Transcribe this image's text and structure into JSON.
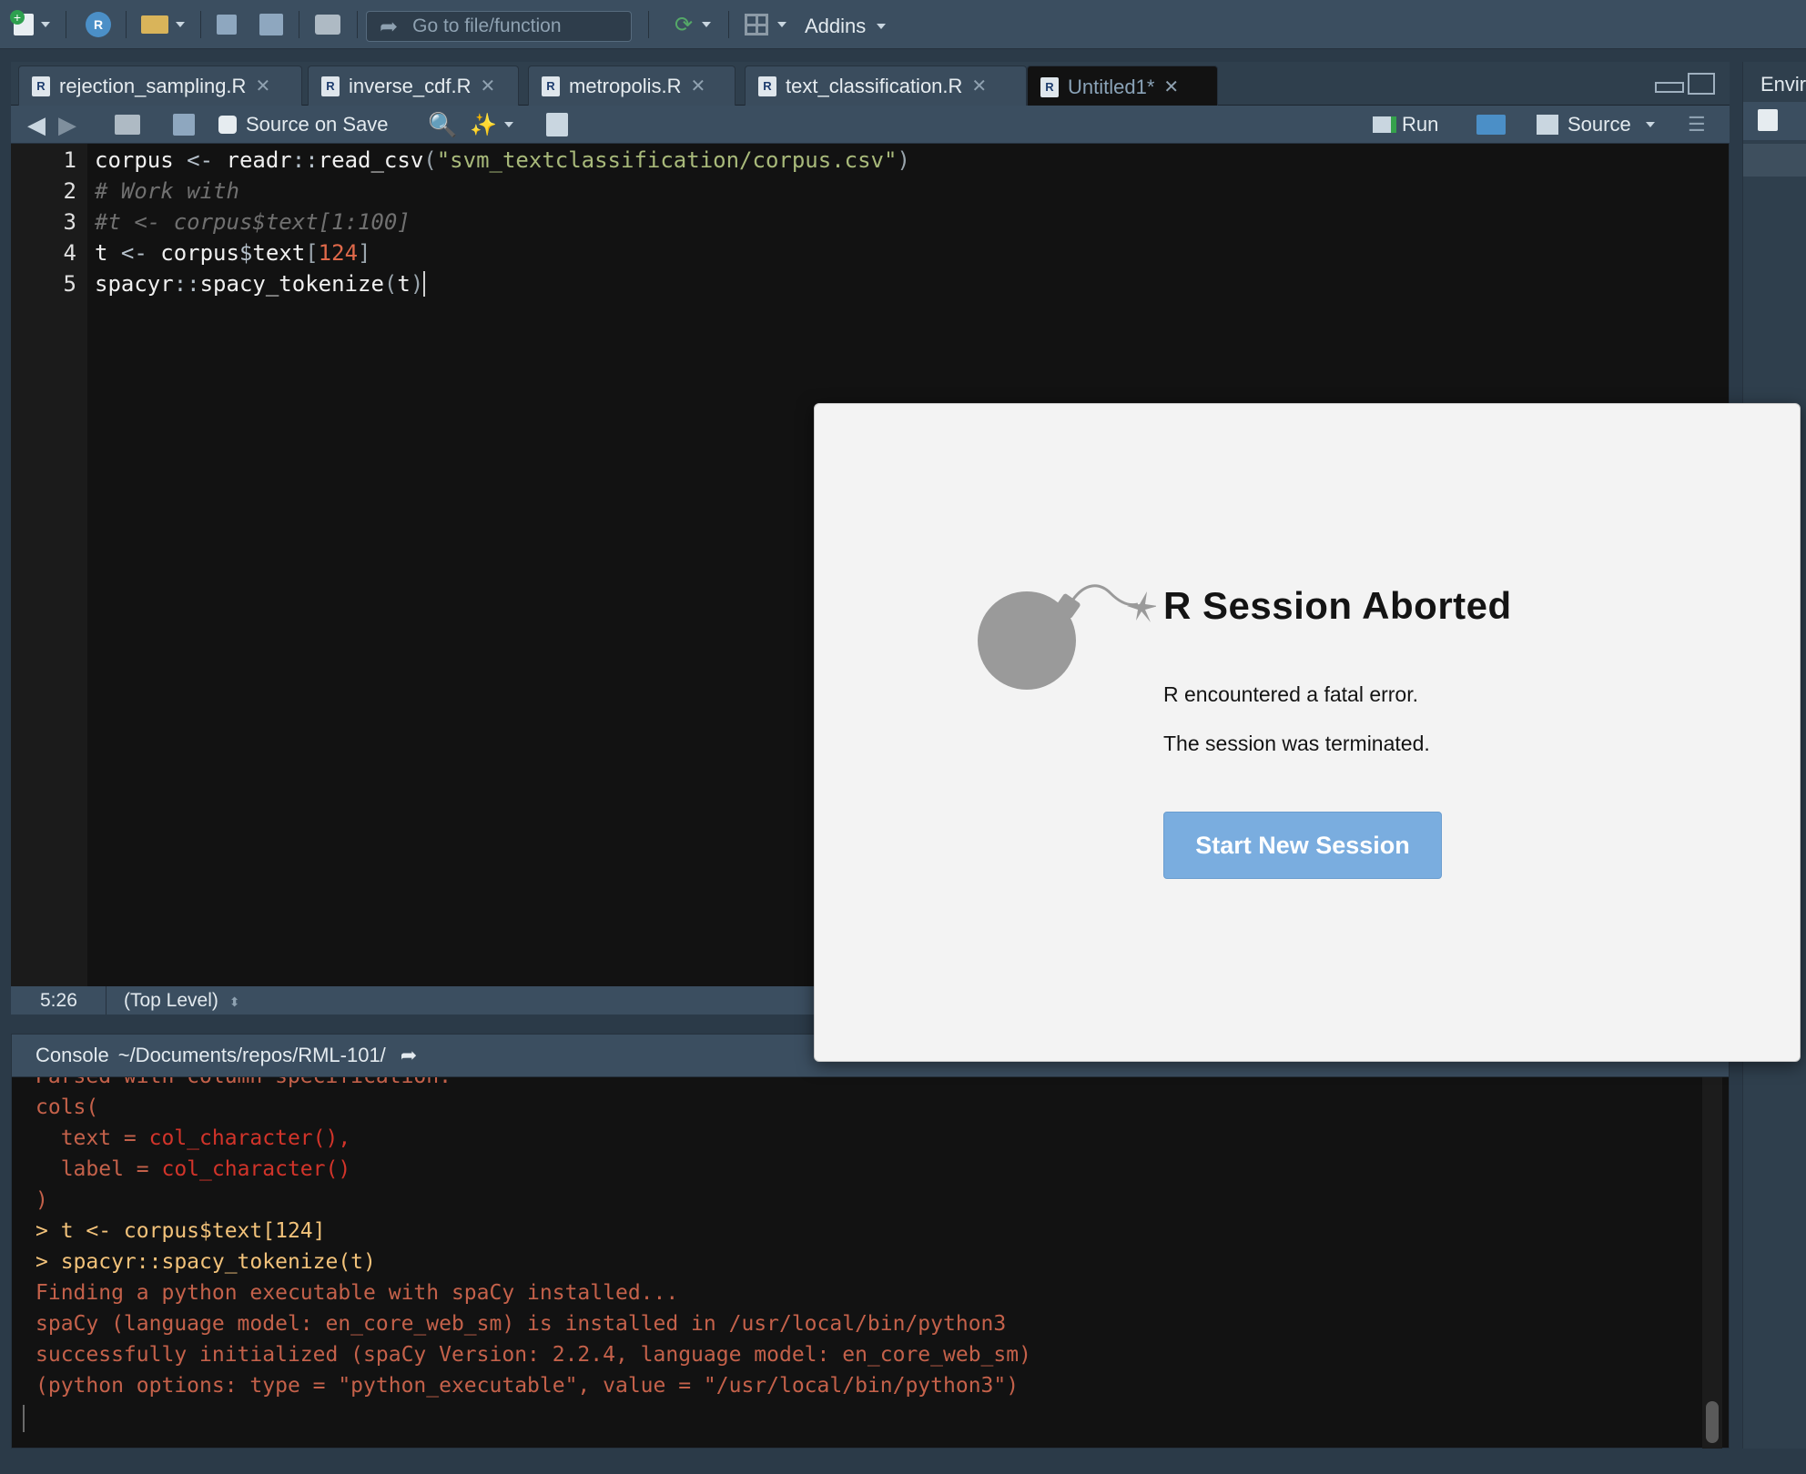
{
  "toolbar": {
    "goto_placeholder": "Go to file/function",
    "addins_label": "Addins"
  },
  "editor": {
    "tabs": [
      {
        "label": "rejection_sampling.R"
      },
      {
        "label": "inverse_cdf.R"
      },
      {
        "label": "metropolis.R"
      },
      {
        "label": "text_classification.R"
      },
      {
        "label": "Untitled1*"
      }
    ],
    "source_on_save_label": "Source on Save",
    "run_label": "Run",
    "source_label": "Source",
    "line_numbers": [
      "1",
      "2",
      "3",
      "4",
      "5"
    ],
    "cursor_position": "5:26",
    "scope": "(Top Level)"
  },
  "console": {
    "title": "Console",
    "path": "~/Documents/repos/RML-101/",
    "lines": {
      "l0": "Parsed with column specification:",
      "l1": "cols(",
      "l2a": "  text = ",
      "l2b": "col_character(),",
      "l3a": "  label = ",
      "l3b": "col_character()",
      "l4": ")",
      "l5": "> t <- corpus$text[124]",
      "l6": "> spacyr::spacy_tokenize(t)",
      "l7": "Finding a python executable with spaCy installed...",
      "l8": "spaCy (language model: en_core_web_sm) is installed in /usr/local/bin/python3",
      "l9": "successfully initialized (spaCy Version: 2.2.4, language model: en_core_web_sm)",
      "l10": "(python options: type = \"python_executable\", value = \"/usr/local/bin/python3\")"
    }
  },
  "right_pane": {
    "title": "Envir"
  },
  "dialog": {
    "title": "R Session Aborted",
    "message1": "R encountered a fatal error.",
    "message2": "The session was terminated.",
    "button_label": "Start New Session",
    "icon": "bomb-icon"
  },
  "colors": {
    "accent_button": "#7aaddf",
    "console_error": "#c4614a"
  }
}
